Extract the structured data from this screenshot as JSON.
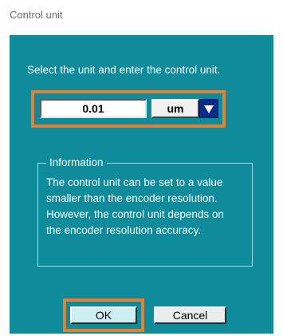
{
  "window": {
    "title": "Control unit"
  },
  "dialog": {
    "instruction": "Select the unit and enter the control unit.",
    "control_value": "0.01",
    "unit_selected": "um",
    "info": {
      "legend": "Information",
      "lines": [
        "The control unit can be set to a value",
        "smaller than the encoder resolution.",
        "However, the control unit depends on",
        "the encoder resolution accuracy."
      ]
    },
    "buttons": {
      "ok_label": "OK",
      "cancel_label": "Cancel"
    }
  },
  "colors": {
    "dialog_background": "#0e8c9b",
    "highlight": "#e87f30",
    "dropdown_button": "#0a2a8a"
  },
  "icons": {
    "dropdown": "triangle-down-icon"
  }
}
